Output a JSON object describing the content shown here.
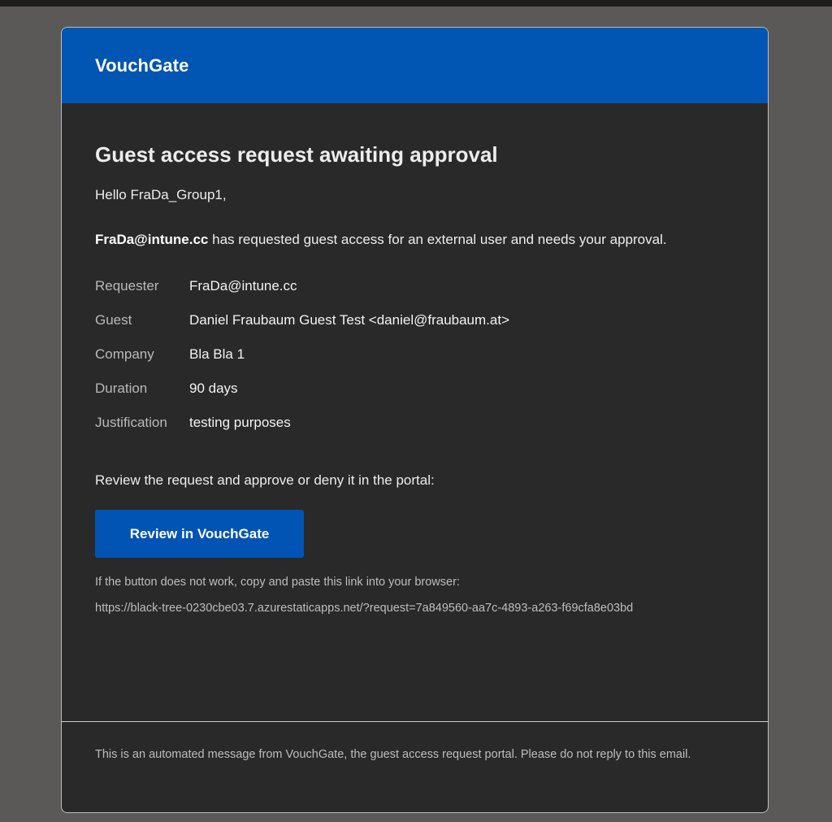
{
  "brand": "VouchGate",
  "title": "Guest access request awaiting approval",
  "greeting": "Hello FraDa_Group1,",
  "intro": {
    "requester": "FraDa@intune.cc",
    "message": " has requested guest access for an external user and needs your approval."
  },
  "details": [
    {
      "label": "Requester",
      "value": "FraDa@intune.cc"
    },
    {
      "label": "Guest",
      "value": "Daniel Fraubaum Guest Test <daniel@fraubaum.at>"
    },
    {
      "label": "Company",
      "value": "Bla Bla 1"
    },
    {
      "label": "Duration",
      "value": "90 days"
    },
    {
      "label": "Justification",
      "value": "testing purposes"
    }
  ],
  "review_text": "Review the request and approve or deny it in the portal:",
  "review_button": "Review in VouchGate",
  "fallback_text": "If the button does not work, copy and paste this link into your browser:",
  "fallback_link": "https://black-tree-0230cbe03.7.azurestaticapps.net/?request=7a849560-aa7c-4893-a263-f69cfa8e03bd",
  "footer": "This is an automated message from VouchGate, the guest access request portal. Please do not reply to this email.",
  "colors": {
    "header": "#0156b3",
    "button": "#0154b3",
    "card": "#292929",
    "background": "#5a5958"
  }
}
